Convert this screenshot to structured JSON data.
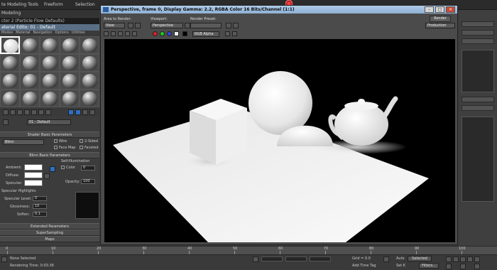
{
  "topbar": {
    "left_label": "te Modeling Tools",
    "freeform": "Freeform",
    "selection": "Selection",
    "modeling": "Modeling"
  },
  "material_editor": {
    "title": "ctor 2 (Particle Flow Defaults)",
    "window_title": "aterial Edito: 01 - Default",
    "menu": [
      "Modes",
      "Material",
      "Navigation",
      "Options",
      "Utilities"
    ],
    "material_name": "01 - Default",
    "shader_basic_rollout": "Shader Basic Parameters",
    "shader_type": "Blinn",
    "wire_label": "Wire",
    "two_sided_label": "2-Sided",
    "face_map_label": "Face Map",
    "faceted_label": "Faceted",
    "blinn_basic_rollout": "Blinn Basic Parameters",
    "self_illum_label": "Self-Illumination",
    "color_label": "Color",
    "self_illum_value": "0",
    "ambient_label": "Ambient:",
    "diffuse_label": "Diffuse:",
    "specular_label": "Specular:",
    "opacity_label": "Opacity:",
    "opacity_value": "100",
    "spec_highlights_label": "Specular Highlights",
    "spec_level_label": "Specular Level:",
    "spec_level_value": "0",
    "glossiness_label": "Glossiness:",
    "glossiness_value": "10",
    "soften_label": "Soften:",
    "soften_value": "0.1",
    "extended_rollout": "Extended Parameters",
    "supersampling_rollout": "SuperSampling",
    "maps_rollout": "Maps"
  },
  "render_window": {
    "title": "Perspective, frame 0, Display Gamma: 2.2, RGBA Color 16 Bits/Channel (1:1)",
    "area_to_render_label": "Area to Render:",
    "area_to_render_value": "View",
    "viewport_label": "Viewport:",
    "viewport_value": "Perspective",
    "render_preset_label": "Render Preset:",
    "render_label": "Render",
    "render_mode_value": "Production",
    "channel_value": "RGB Alpha"
  },
  "status_bar": {
    "selection": "None Selected",
    "rendering_time": "Rendering Time: 0:03:36",
    "grid": "Grid = 0.0",
    "add_time_tag": "Add Time Tag",
    "auto": "Auto",
    "selected": "Selected",
    "set_key": "Set K",
    "filters": "Filters..."
  },
  "timeline": {
    "ticks": [
      "0",
      "10",
      "20",
      "30",
      "40",
      "50",
      "60",
      "70",
      "80",
      "90",
      "100"
    ]
  }
}
